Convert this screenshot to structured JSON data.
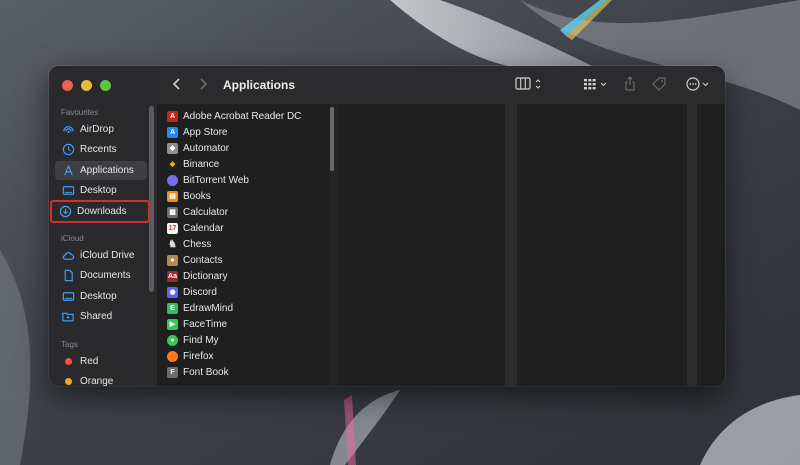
{
  "window": {
    "title": "Applications"
  },
  "sidebar": {
    "favourites_label": "Favourites",
    "icloud_label": "iCloud",
    "tags_label": "Tags",
    "favourites": [
      {
        "label": "AirDrop",
        "icon": "airdrop-icon"
      },
      {
        "label": "Recents",
        "icon": "clock-icon"
      },
      {
        "label": "Applications",
        "icon": "applications-icon",
        "selected": true
      },
      {
        "label": "Desktop",
        "icon": "desktop-icon"
      },
      {
        "label": "Downloads",
        "icon": "download-icon",
        "highlighted": true
      }
    ],
    "icloud": [
      {
        "label": "iCloud Drive",
        "icon": "cloud-icon"
      },
      {
        "label": "Documents",
        "icon": "document-icon"
      },
      {
        "label": "Desktop",
        "icon": "desktop-icon"
      },
      {
        "label": "Shared",
        "icon": "shared-folder-icon"
      }
    ],
    "tags": [
      {
        "label": "Red",
        "color": "#f4524b"
      },
      {
        "label": "Orange",
        "color": "#f5a623"
      }
    ]
  },
  "files": [
    {
      "label": "Adobe Acrobat Reader DC",
      "icon": "acrobat-icon",
      "color": "#c4261d"
    },
    {
      "label": "App Store",
      "icon": "app-store-icon",
      "color": "#1d8cf8"
    },
    {
      "label": "Automator",
      "icon": "automator-icon",
      "color": "#8e8e93"
    },
    {
      "label": "Binance",
      "icon": "binance-icon",
      "color": "#f0b90b"
    },
    {
      "label": "BitTorrent Web",
      "icon": "bittorrent-icon",
      "color": "#7a6cf0"
    },
    {
      "label": "Books",
      "icon": "books-icon",
      "color": "#f28a1c"
    },
    {
      "label": "Calculator",
      "icon": "calculator-icon",
      "color": "#6d6d70"
    },
    {
      "label": "Calendar",
      "icon": "calendar-icon",
      "color": "#f4f4f4"
    },
    {
      "label": "Chess",
      "icon": "chess-icon",
      "color": "#555555"
    },
    {
      "label": "Contacts",
      "icon": "contacts-icon",
      "color": "#b58a5a"
    },
    {
      "label": "Dictionary",
      "icon": "dictionary-icon",
      "color": "#9b2a2a"
    },
    {
      "label": "Discord",
      "icon": "discord-icon",
      "color": "#5865f2"
    },
    {
      "label": "EdrawMind",
      "icon": "edrawmind-icon",
      "color": "#3fb66c"
    },
    {
      "label": "FaceTime",
      "icon": "facetime-icon",
      "color": "#34c759"
    },
    {
      "label": "Find My",
      "icon": "find-my-icon",
      "color": "#34c759"
    },
    {
      "label": "Firefox",
      "icon": "firefox-icon",
      "color": "#ff7a1a"
    },
    {
      "label": "Font Book",
      "icon": "font-book-icon",
      "color": "#6d6d70"
    }
  ],
  "colors": {
    "selection": "#3e3f43",
    "highlight_border": "#d32f2f",
    "window_bg": "#1e1e1e"
  }
}
